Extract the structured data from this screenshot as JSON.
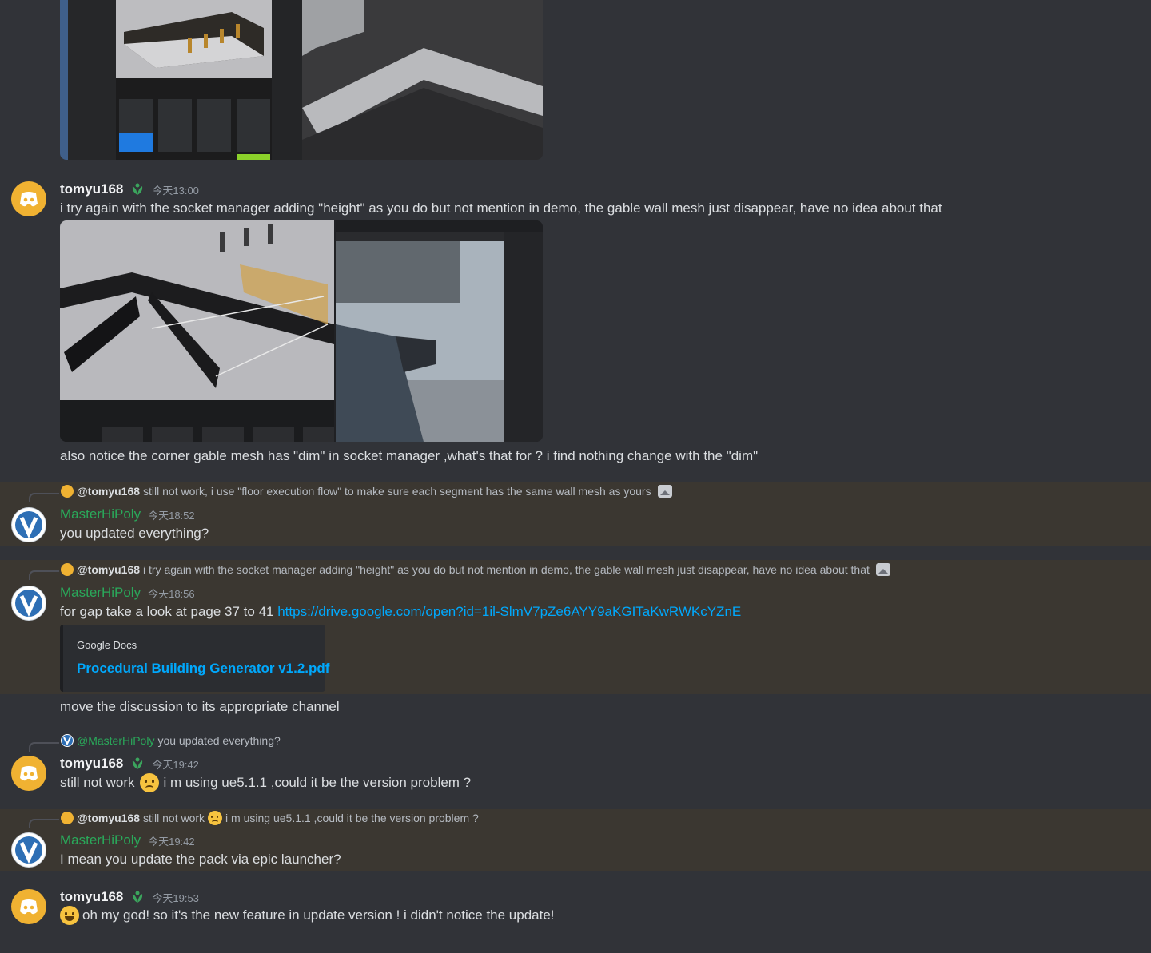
{
  "messages": [
    {
      "author": "tomyu168",
      "time": "今天13:00",
      "text": "i try again with the socket manager adding \"height\" as you do but not mention in demo, the gable wall mesh just disappear, have no idea about that",
      "followup": "also notice the corner gable mesh has \"dim\" in socket manager ,what's that for ? i find nothing change with the \"dim\""
    },
    {
      "reply_author": "@tomyu168",
      "reply_text": "still not work, i use \"floor execution flow\" to make sure each segment has the same wall mesh as yours",
      "author": "MasterHiPoly",
      "time": "今天18:52",
      "text": "you updated everything?"
    },
    {
      "reply_author": "@tomyu168",
      "reply_text": "i try again with the socket manager adding \"height\" as you do but not mention in demo, the gable wall mesh just disappear, have no idea about that",
      "author": "MasterHiPoly",
      "time": "今天18:56",
      "text": "for gap take a look at page 37 to 41",
      "link": "https://drive.google.com/open?id=1il-SlmV7pZe6AYY9aKGITaKwRWKcYZnE",
      "embed_provider": "Google Docs",
      "embed_title": "Procedural Building Generator v1.2.pdf",
      "followup": "move the discussion to its appropriate channel"
    },
    {
      "reply_author": "@MasterHiPoly",
      "reply_text": "you updated everything?",
      "author": "tomyu168",
      "time": "今天19:42",
      "text_a": "still not work",
      "text_b": "i m using ue5.1.1 ,could it be the version problem ?"
    },
    {
      "reply_author": "@tomyu168",
      "reply_text_a": "still not work",
      "reply_text_b": "i m using ue5.1.1 ,could it be the version problem ?",
      "author": "MasterHiPoly",
      "time": "今天19:42",
      "text": "I mean you update the pack via epic launcher?"
    },
    {
      "author": "tomyu168",
      "time": "今天19:53",
      "text": "oh my god! so it's the new feature in update version ! i didn't notice the update!"
    }
  ],
  "colors": {
    "background": "#313338",
    "highlight": "#3b3731",
    "link": "#00a8fc",
    "moderator_name": "#2aa85a",
    "discord_avatar": "#f0b232"
  },
  "icons": [
    "discord-logo-icon",
    "leaf-badge-icon",
    "image-attachment-icon",
    "sad-face-emoji",
    "grin-emoji"
  ]
}
